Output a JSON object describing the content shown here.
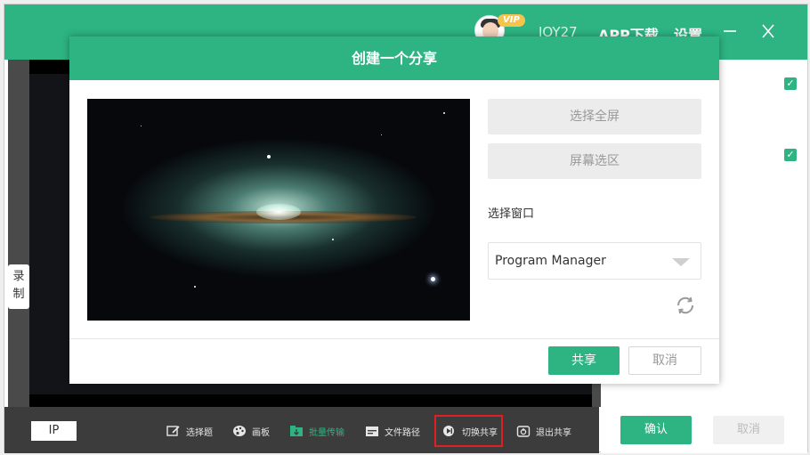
{
  "titlebar": {
    "vip_badge": "VIP",
    "username": "JOY27",
    "app_download": "APP下载",
    "settings": "设置",
    "minimize_icon": "minimize-icon",
    "close_icon": "close-icon"
  },
  "left_panel": {
    "side_tab_label": "录制"
  },
  "toolbar": {
    "ip_label": "IP",
    "items": [
      {
        "label": "选择题",
        "icon": "edit-icon"
      },
      {
        "label": "画板",
        "icon": "palette-icon"
      },
      {
        "label": "批量传输",
        "icon": "batch-transfer-icon",
        "active": true
      },
      {
        "label": "文件路径",
        "icon": "folder-icon"
      },
      {
        "label": "切换共享",
        "icon": "switch-share-icon",
        "highlighted": true
      },
      {
        "label": "退出共享",
        "icon": "exit-share-icon"
      }
    ]
  },
  "right_panel": {
    "confirm_label": "确认",
    "cancel_label": "取消"
  },
  "modal": {
    "title": "创建一个分享",
    "select_fullscreen": "选择全屏",
    "screen_region": "屏幕选区",
    "select_window_label": "选择窗口",
    "window_selected": "Program Manager",
    "share_label": "共享",
    "cancel_label": "取消"
  },
  "colors": {
    "accent": "#2db482",
    "highlight_border": "#e02020"
  }
}
